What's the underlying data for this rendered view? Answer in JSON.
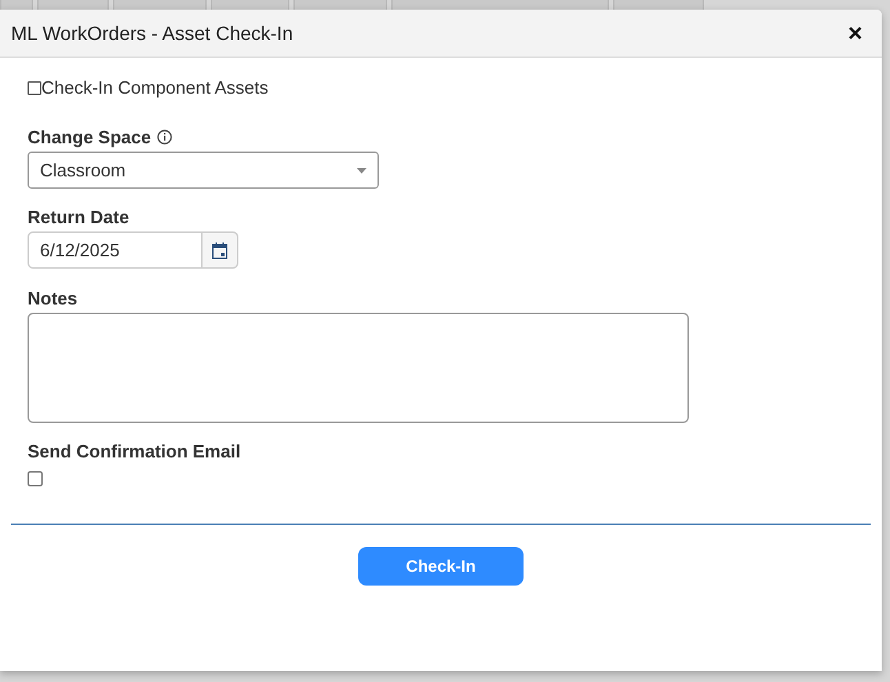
{
  "dialog": {
    "title": "ML WorkOrders - Asset Check-In",
    "close": "×",
    "component_assets": {
      "label": "Check-In Component Assets",
      "checked": false
    },
    "change_space": {
      "label": "Change Space",
      "value": "Classroom"
    },
    "return_date": {
      "label": "Return Date",
      "value": "6/12/2025"
    },
    "notes": {
      "label": "Notes"
    },
    "send_email": {
      "label": "Send Confirmation Email",
      "checked": false
    },
    "submit": "Check-In"
  }
}
